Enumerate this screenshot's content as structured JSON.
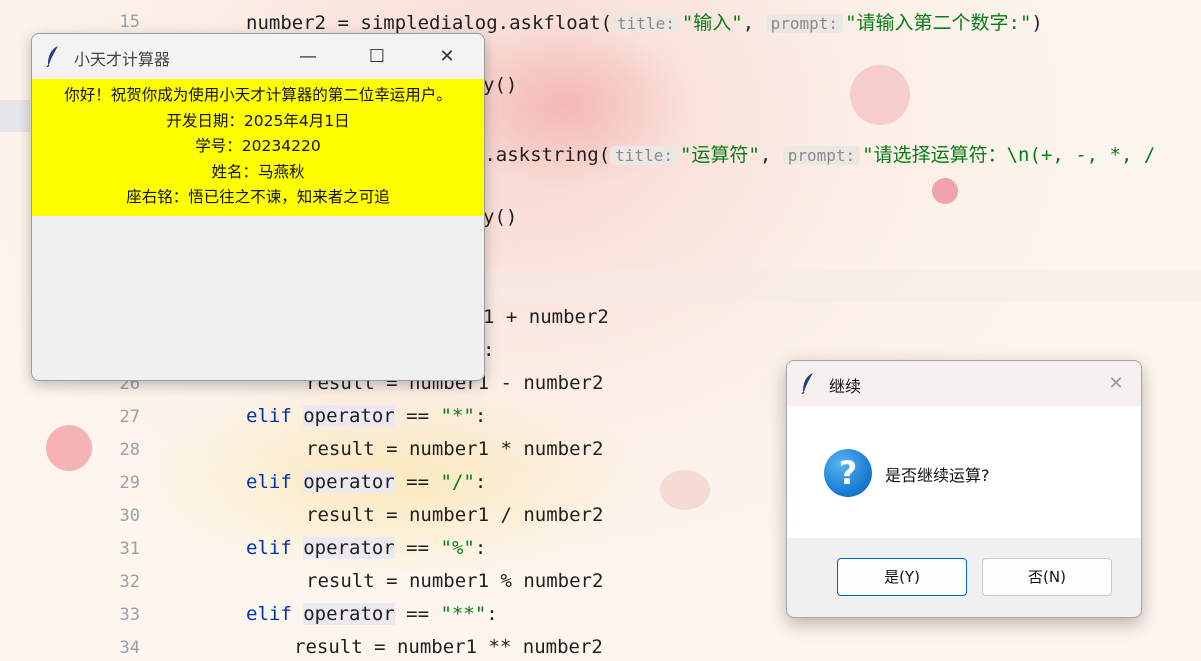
{
  "editor": {
    "line_numbers": [
      "15",
      "26",
      "27",
      "28",
      "29",
      "30",
      "31",
      "32",
      "33",
      "34"
    ],
    "line15": {
      "code_a": "number2 = simpledialog.askfloat(",
      "hint_title": "title:",
      "str_title": "\"输入\"",
      "sep": ", ",
      "hint_prompt": "prompt:",
      "str_prompt": "\"请输入第二个数字:\"",
      "close": ")"
    },
    "line_y": "y()",
    "line_askstring": {
      "code_a": "log.askstring(",
      "hint_title": "title:",
      "str_title": "\"运算符\"",
      "sep": ", ",
      "hint_prompt": "prompt:",
      "str_prompt": "\"请选择运算符：\\n(+, -, *, /"
    },
    "line_y2": "y()",
    "line_plus": "1 + number2",
    "line_colon": ":",
    "line26": "result = number1 - number2",
    "line27": {
      "kw": "elif",
      "var": "operator",
      "op": " == ",
      "str": "\"*\"",
      "end": ":"
    },
    "line28": "result = number1 * number2",
    "line29": {
      "kw": "elif",
      "var": "operator",
      "op": " == ",
      "str": "\"/\"",
      "end": ":"
    },
    "line30": "result = number1 / number2",
    "line31": {
      "kw": "elif",
      "var": "operator",
      "op": " == ",
      "str": "\"%\"",
      "end": ":"
    },
    "line32": "result = number1 % number2",
    "line33": {
      "kw": "elif",
      "var": "operator",
      "op": " == ",
      "str": "\"**\"",
      "end": ":"
    },
    "line34": "result = number1 ** number2"
  },
  "main_window": {
    "title": "小天才计算器",
    "minimize": "—",
    "maximize": "☐",
    "close": "✕",
    "lines": [
      "你好！祝贺你成为使用小天才计算器的第二位幸运用户。",
      "开发日期：2025年4月1日",
      "学号：20234220",
      "姓名：马燕秋",
      "座右铭：悟已往之不谏，知来者之可追"
    ]
  },
  "dialog": {
    "title": "继续",
    "close": "✕",
    "message": "是否继续运算?",
    "icon_glyph": "?",
    "yes_label": "是(Y)",
    "no_label": "否(N)"
  },
  "colors": {
    "panel_yellow": "#ffff00",
    "keyword": "#0033b3",
    "string": "#067d17",
    "accent": "#0067c0"
  }
}
